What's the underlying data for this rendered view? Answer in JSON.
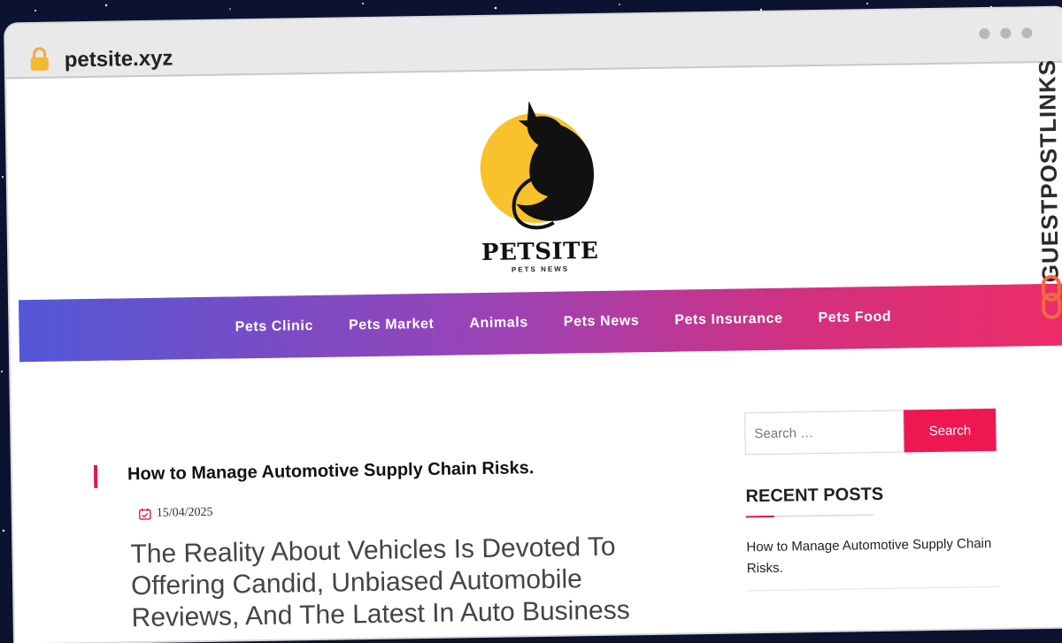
{
  "browser": {
    "url": "petsite.xyz"
  },
  "site": {
    "logo_title": "PETSITE",
    "logo_subtitle": "PETS NEWS",
    "accent_color": "#ee1752",
    "logo_circle_color": "#f7c22b"
  },
  "nav": {
    "items": [
      {
        "label": "Pets Clinic"
      },
      {
        "label": "Pets Market"
      },
      {
        "label": "Animals"
      },
      {
        "label": "Pets News"
      },
      {
        "label": "Pets Insurance"
      },
      {
        "label": "Pets Food"
      }
    ]
  },
  "post": {
    "title": "How to Manage Automotive Supply Chain Risks.",
    "date": "15/04/2025",
    "heading": "The Reality About Vehicles Is Devoted To Offering Candid, Unbiased Automobile Reviews, And The Latest In Auto Business"
  },
  "sidebar": {
    "search_placeholder": "Search …",
    "search_button": "Search",
    "recent_title": "RECENT POSTS",
    "recent_items": [
      {
        "label": "How to Manage Automotive Supply Chain Risks."
      }
    ]
  },
  "badge": {
    "text": "GUESTPOSTLINKS"
  }
}
